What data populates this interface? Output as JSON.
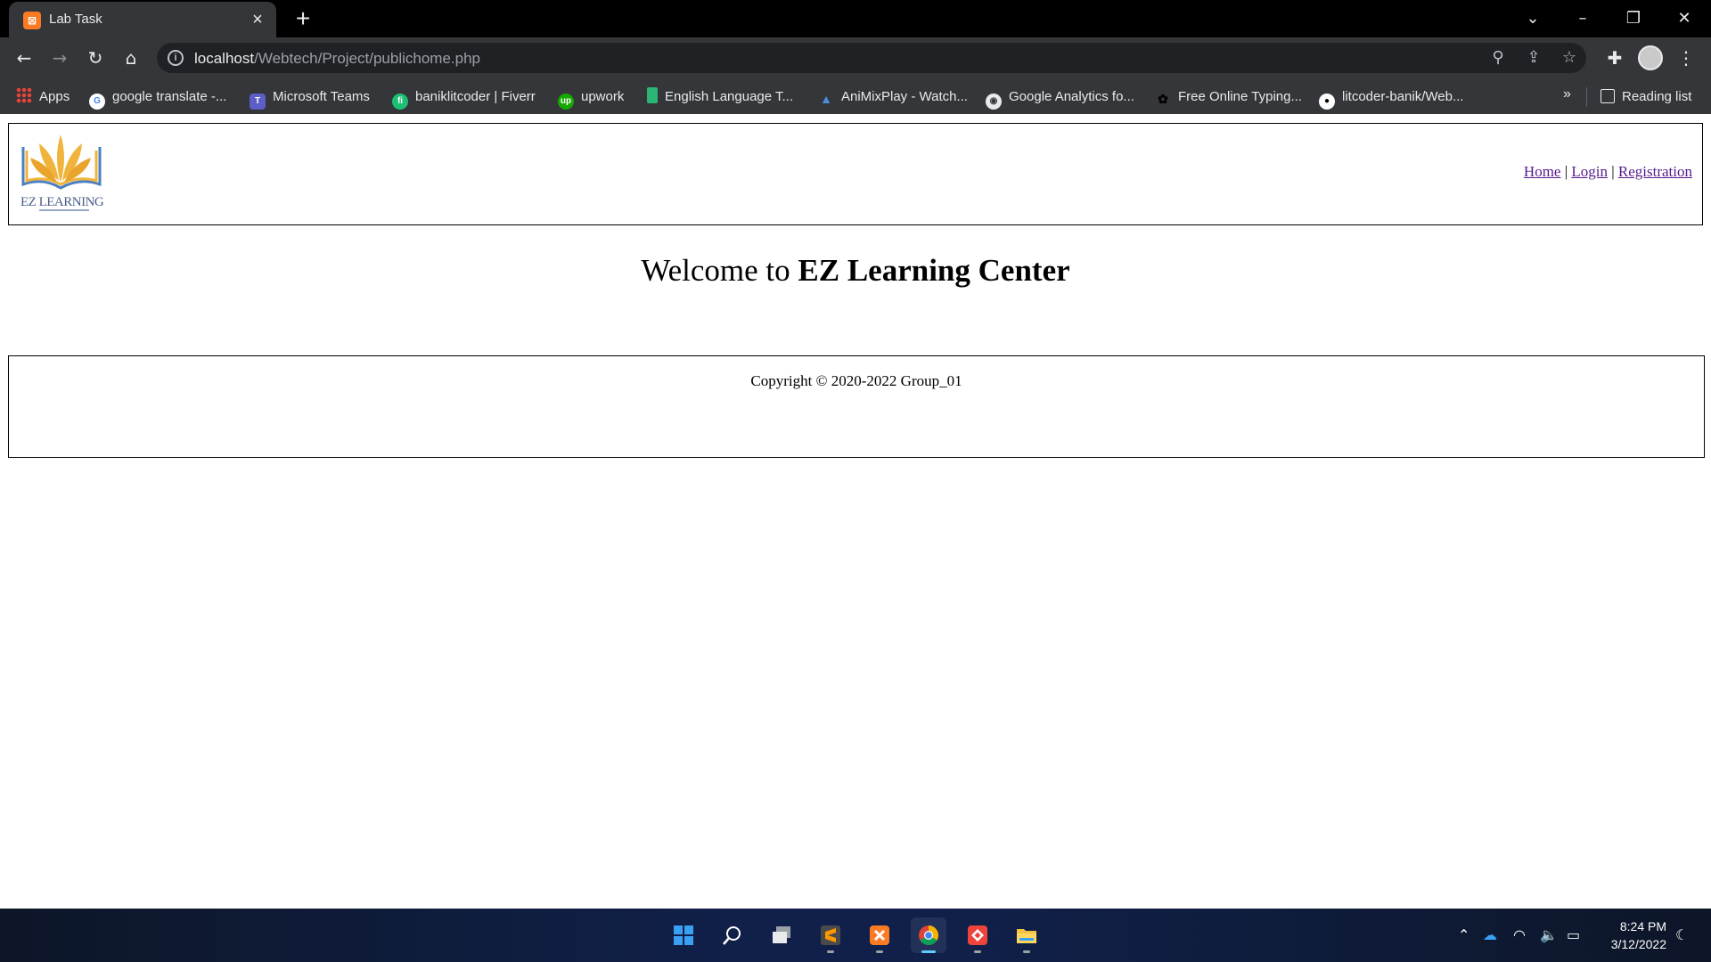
{
  "browser": {
    "tab": {
      "title": "Lab Task"
    },
    "address": {
      "host": "localhost",
      "path": "/Webtech/Project/publichome.php"
    },
    "bookmarks": [
      {
        "label": "Apps",
        "icon": "apps-grid-icon"
      },
      {
        "label": "google translate -...",
        "icon": "google-icon"
      },
      {
        "label": "Microsoft Teams",
        "icon": "teams-icon"
      },
      {
        "label": "baniklitcoder | Fiverr",
        "icon": "fiverr-icon"
      },
      {
        "label": "upwork",
        "icon": "upwork-icon"
      },
      {
        "label": "English Language T...",
        "icon": "bookmark-green-icon"
      },
      {
        "label": "AniMixPlay - Watch...",
        "icon": "animixplay-icon"
      },
      {
        "label": "Google Analytics fo...",
        "icon": "globe-icon"
      },
      {
        "label": "Free Online Typing...",
        "icon": "paw-icon"
      },
      {
        "label": "litcoder-banik/Web...",
        "icon": "github-icon"
      }
    ],
    "more_bookmarks": "»",
    "reading_list": "Reading list"
  },
  "page": {
    "logo": {
      "text": "EZ LEARNING"
    },
    "nav": {
      "home": "Home",
      "separator": "|",
      "login": "Login",
      "registration": "Registration"
    },
    "welcome": {
      "prefix": "Welcome to ",
      "name": "EZ Learning Center"
    },
    "footer": {
      "copyright": "Copyright © 2020-2022 Group_01"
    }
  },
  "taskbar": {
    "time": "8:24 PM",
    "date": "3/12/2022"
  },
  "colors": {
    "chrome_bg": "#35363a",
    "link": "#551a8b",
    "logo_gold": "#f0b43c",
    "logo_blue": "#4a7fc1",
    "taskbar_accent": "#60cdff"
  }
}
